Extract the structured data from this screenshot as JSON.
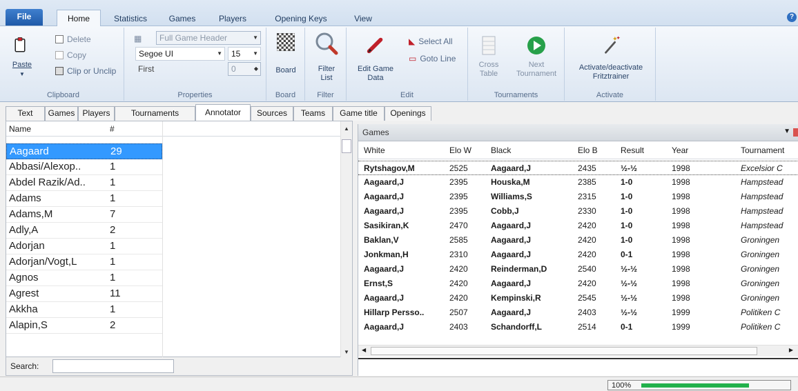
{
  "ribbon_tabs": {
    "file": "File",
    "home": "Home",
    "statistics": "Statistics",
    "games": "Games",
    "players": "Players",
    "opening_keys": "Opening Keys",
    "view": "View"
  },
  "clipboard": {
    "delete": "Delete",
    "copy": "Copy",
    "paste": "Paste",
    "clip_unclip": "Clip or Unclip",
    "group": "Clipboard"
  },
  "properties": {
    "header_combo": "Full Game Header",
    "font_combo": "Segoe UI",
    "size_combo": "15",
    "first_label": "First",
    "first_value": "0",
    "group": "Properties"
  },
  "board": {
    "button": "Board",
    "group": "Board"
  },
  "filter": {
    "button_line1": "Filter",
    "button_line2": "List",
    "group": "Filter"
  },
  "edit": {
    "edit_game_line1": "Edit Game",
    "edit_game_line2": "Data",
    "select_all": "Select All",
    "goto_line": "Goto Line",
    "group": "Edit"
  },
  "tournaments": {
    "cross_line1": "Cross",
    "cross_line2": "Table",
    "next_line1": "Next",
    "next_line2": "Tournament",
    "group": "Tournaments"
  },
  "activate": {
    "button_line1": "Activate/deactivate",
    "button_line2": "Fritztrainer",
    "group": "Activate"
  },
  "subtabs": [
    "Text",
    "Games",
    "Players",
    "Tournaments",
    "Annotator",
    "Sources",
    "Teams",
    "Game title",
    "Openings"
  ],
  "annotator_list": {
    "col_name": "Name",
    "col_count": "#",
    "rows": [
      {
        "name": "Aagaard",
        "count": "29"
      },
      {
        "name": "Abbasi/Alexop..",
        "count": "1"
      },
      {
        "name": "Abdel Razik/Ad..",
        "count": "1"
      },
      {
        "name": "Adams",
        "count": "1"
      },
      {
        "name": "Adams,M",
        "count": "7"
      },
      {
        "name": "Adly,A",
        "count": "2"
      },
      {
        "name": "Adorjan",
        "count": "1"
      },
      {
        "name": "Adorjan/Vogt,L",
        "count": "1"
      },
      {
        "name": "Agnos",
        "count": "1"
      },
      {
        "name": "Agrest",
        "count": "11"
      },
      {
        "name": "Akkha",
        "count": "1"
      },
      {
        "name": "Alapin,S",
        "count": "2"
      }
    ]
  },
  "search": {
    "label": "Search:",
    "value": ""
  },
  "games": {
    "title": "Games",
    "columns": {
      "white": "White",
      "elo_w": "Elo W",
      "black": "Black",
      "elo_b": "Elo B",
      "result": "Result",
      "year": "Year",
      "tournament": "Tournament"
    },
    "rows": [
      {
        "white": "Rytshagov,M",
        "elo_w": "2525",
        "black": "Aagaard,J",
        "elo_b": "2435",
        "result": "½-½",
        "year": "1998",
        "tournament": "Excelsior C"
      },
      {
        "white": "Aagaard,J",
        "elo_w": "2395",
        "black": "Houska,M",
        "elo_b": "2385",
        "result": "1-0",
        "year": "1998",
        "tournament": "Hampstead"
      },
      {
        "white": "Aagaard,J",
        "elo_w": "2395",
        "black": "Williams,S",
        "elo_b": "2315",
        "result": "1-0",
        "year": "1998",
        "tournament": "Hampstead"
      },
      {
        "white": "Aagaard,J",
        "elo_w": "2395",
        "black": "Cobb,J",
        "elo_b": "2330",
        "result": "1-0",
        "year": "1998",
        "tournament": "Hampstead"
      },
      {
        "white": "Sasikiran,K",
        "elo_w": "2470",
        "black": "Aagaard,J",
        "elo_b": "2420",
        "result": "1-0",
        "year": "1998",
        "tournament": "Hampstead"
      },
      {
        "white": "Baklan,V",
        "elo_w": "2585",
        "black": "Aagaard,J",
        "elo_b": "2420",
        "result": "1-0",
        "year": "1998",
        "tournament": "Groningen"
      },
      {
        "white": "Jonkman,H",
        "elo_w": "2310",
        "black": "Aagaard,J",
        "elo_b": "2420",
        "result": "0-1",
        "year": "1998",
        "tournament": "Groningen"
      },
      {
        "white": "Aagaard,J",
        "elo_w": "2420",
        "black": "Reinderman,D",
        "elo_b": "2540",
        "result": "½-½",
        "year": "1998",
        "tournament": "Groningen"
      },
      {
        "white": "Ernst,S",
        "elo_w": "2420",
        "black": "Aagaard,J",
        "elo_b": "2420",
        "result": "½-½",
        "year": "1998",
        "tournament": "Groningen"
      },
      {
        "white": "Aagaard,J",
        "elo_w": "2420",
        "black": "Kempinski,R",
        "elo_b": "2545",
        "result": "½-½",
        "year": "1998",
        "tournament": "Groningen"
      },
      {
        "white": "Hillarp Persso..",
        "elo_w": "2507",
        "black": "Aagaard,J",
        "elo_b": "2403",
        "result": "½-½",
        "year": "1999",
        "tournament": "Politiken C"
      },
      {
        "white": "Aagaard,J",
        "elo_w": "2403",
        "black": "Schandorff,L",
        "elo_b": "2514",
        "result": "0-1",
        "year": "1999",
        "tournament": "Politiken C"
      }
    ]
  },
  "status": {
    "progress_label": "100%",
    "progress_fraction": 1.0
  },
  "colors": {
    "accent": "#3399ff",
    "file_tab": "#1f5aa8",
    "progress": "#22b14c"
  }
}
